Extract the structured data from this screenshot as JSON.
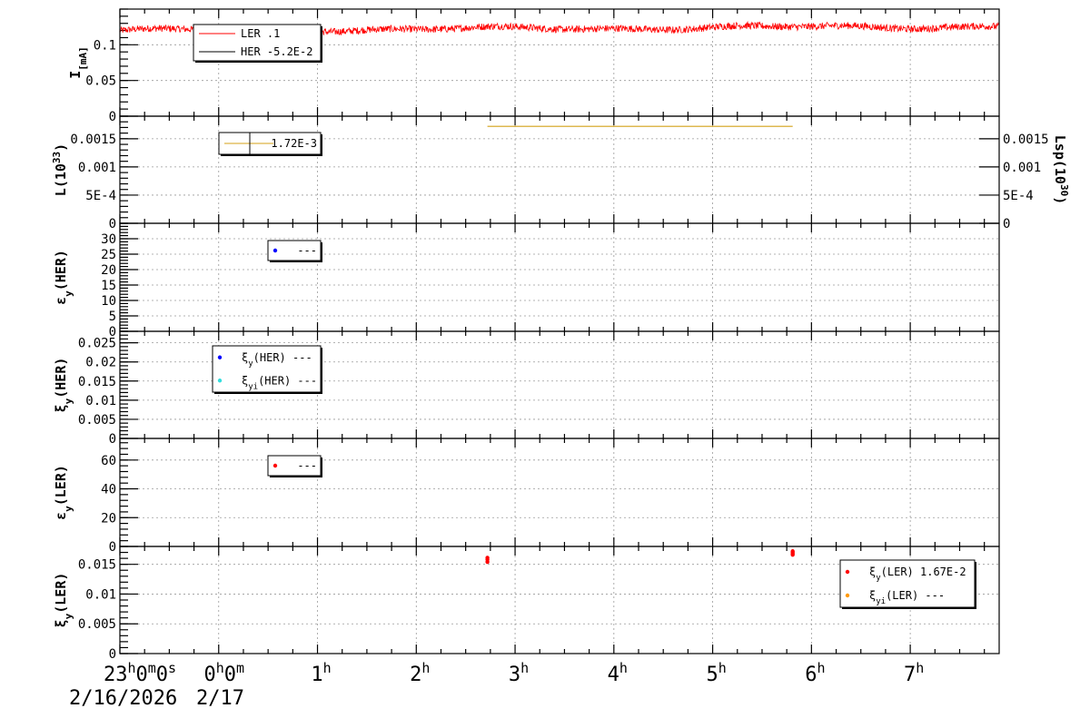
{
  "chart_data": {
    "type": "line",
    "x_axis": {
      "unit": "hours since 2026-02-16 23:00",
      "range": [
        0,
        8.9
      ],
      "labels": [
        {
          "x": 0,
          "text": "23",
          "sup": "h",
          "rest": "0",
          "sup2": "m",
          "rest2": "0",
          "sup3": "s"
        },
        {
          "x": 1,
          "text": "0",
          "sup": "h",
          "rest": "0",
          "sup2": "m"
        },
        {
          "x": 2,
          "text": "1",
          "sup": "h"
        },
        {
          "x": 3,
          "text": "2",
          "sup": "h"
        },
        {
          "x": 4,
          "text": "3",
          "sup": "h"
        },
        {
          "x": 5,
          "text": "4",
          "sup": "h"
        },
        {
          "x": 6,
          "text": "5",
          "sup": "h"
        },
        {
          "x": 7,
          "text": "6",
          "sup": "h"
        },
        {
          "x": 8,
          "text": "7",
          "sup": "h"
        }
      ],
      "dates": [
        "2/16/2026",
        "2/17"
      ],
      "grid": true
    },
    "panels": [
      {
        "id": "current",
        "ylabel": "I",
        "ylabel_sub": "[mA]",
        "ylim": [
          0,
          0.15
        ],
        "yticks": [
          {
            "v": 0,
            "t": "0"
          },
          {
            "v": 0.05,
            "t": "0.05"
          },
          {
            "v": 0.1,
            "t": "0.1"
          }
        ],
        "series": [
          {
            "name": "LER",
            "value": ".1",
            "color": "#ff0000",
            "kind": "noisy",
            "x": [
              0,
              8.9
            ],
            "base": 0.12,
            "trend": 0.006,
            "noise": 0.005
          },
          {
            "name": "HER",
            "value": "-5.2E-2",
            "color": "#000000",
            "kind": "none"
          }
        ],
        "legend": {
          "position": "top-left"
        }
      },
      {
        "id": "luminosity",
        "ylabel": "L(10",
        "ylabel_sup": "33",
        "ylabel_end": ")",
        "ylabel_right": "Lsp(10",
        "ylabel_right_sup": "30",
        "ylabel_right_end": ")",
        "ylim": [
          0,
          0.0019
        ],
        "yticks": [
          {
            "v": 0,
            "t": "0"
          },
          {
            "v": 0.0005,
            "t": "5E-4"
          },
          {
            "v": 0.001,
            "t": "0.001"
          },
          {
            "v": 0.0015,
            "t": "0.0015"
          }
        ],
        "series": [
          {
            "name": "",
            "value": "1.72E-3",
            "color": "#d4a017",
            "kind": "segment",
            "x": [
              3.72,
              6.81
            ],
            "y": 0.00172
          }
        ],
        "legend": {
          "position": "top-left"
        }
      },
      {
        "id": "emittance-her",
        "ylabel": "ε",
        "ylabel_sub": "y",
        "ylabel_end": "(HER)",
        "ylim": [
          0,
          35
        ],
        "yticks": [
          {
            "v": 0,
            "t": "0"
          },
          {
            "v": 5,
            "t": "5"
          },
          {
            "v": 10,
            "t": "10"
          },
          {
            "v": 15,
            "t": "15"
          },
          {
            "v": 20,
            "t": "20"
          },
          {
            "v": 25,
            "t": "25"
          },
          {
            "v": 30,
            "t": "30"
          }
        ],
        "series": [
          {
            "name": "",
            "value": "---",
            "color": "#0000ff",
            "kind": "none"
          }
        ],
        "legend": {
          "position": "top-left"
        }
      },
      {
        "id": "xi-her",
        "ylabel": "ξ",
        "ylabel_sub": "y",
        "ylabel_end": "(HER)",
        "ylim": [
          0,
          0.028
        ],
        "yticks": [
          {
            "v": 0,
            "t": "0"
          },
          {
            "v": 0.005,
            "t": "0.005"
          },
          {
            "v": 0.01,
            "t": "0.01"
          },
          {
            "v": 0.015,
            "t": "0.015"
          },
          {
            "v": 0.02,
            "t": "0.02"
          },
          {
            "v": 0.025,
            "t": "0.025"
          }
        ],
        "series": [
          {
            "name": "ξ",
            "name_sub": "y",
            "name_end": "(HER)",
            "value": "---",
            "color": "#0000ff",
            "kind": "none"
          },
          {
            "name": "ξ",
            "name_sub": "yi",
            "name_end": "(HER)",
            "value": "---",
            "color": "#33dddd",
            "kind": "none"
          }
        ],
        "legend": {
          "position": "top-left"
        }
      },
      {
        "id": "emittance-ler",
        "ylabel": "ε",
        "ylabel_sub": "y",
        "ylabel_end": "(LER)",
        "ylim": [
          0,
          75
        ],
        "yticks": [
          {
            "v": 0,
            "t": "0"
          },
          {
            "v": 20,
            "t": "20"
          },
          {
            "v": 40,
            "t": "40"
          },
          {
            "v": 60,
            "t": "60"
          }
        ],
        "series": [
          {
            "name": "",
            "value": "---",
            "color": "#ff0000",
            "kind": "none"
          }
        ],
        "legend": {
          "position": "top-left"
        }
      },
      {
        "id": "xi-ler",
        "ylabel": "ξ",
        "ylabel_sub": "y",
        "ylabel_end": "(LER)",
        "ylim": [
          0,
          0.018
        ],
        "yticks": [
          {
            "v": 0,
            "t": "0"
          },
          {
            "v": 0.005,
            "t": "0.005"
          },
          {
            "v": 0.01,
            "t": "0.01"
          },
          {
            "v": 0.015,
            "t": "0.015"
          }
        ],
        "series": [
          {
            "name": "ξ",
            "name_sub": "y",
            "name_end": "(LER)",
            "value": "1.67E-2",
            "color": "#ff0000",
            "kind": "points",
            "points": [
              [
                3.72,
                0.0154
              ],
              [
                3.72,
                0.0158
              ],
              [
                3.72,
                0.0161
              ],
              [
                6.81,
                0.0166
              ],
              [
                6.81,
                0.0168
              ],
              [
                6.81,
                0.017
              ],
              [
                6.81,
                0.0172
              ]
            ]
          },
          {
            "name": "ξ",
            "name_sub": "yi",
            "name_end": "(LER)",
            "value": "---",
            "color": "#ff9900",
            "kind": "none"
          }
        ],
        "legend": {
          "position": "top-right"
        }
      }
    ]
  }
}
